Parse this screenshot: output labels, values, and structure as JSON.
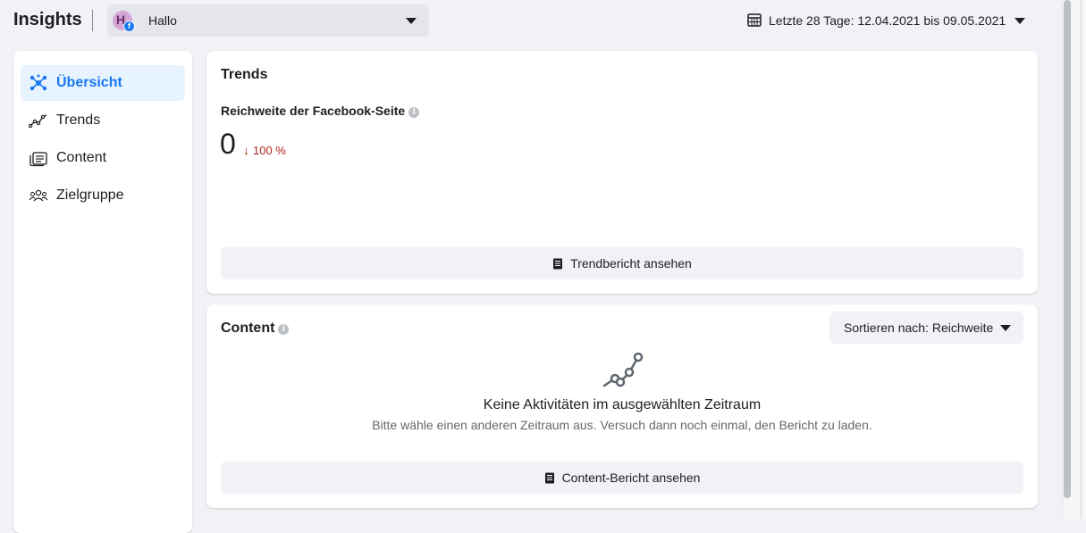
{
  "header": {
    "title": "Insights",
    "page_selector": {
      "avatar_letter": "H",
      "page_name": "Hallo"
    },
    "date_range": "Letzte 28 Tage: 12.04.2021 bis 09.05.2021"
  },
  "sidebar": {
    "items": [
      {
        "label": "Übersicht",
        "icon": "overview-icon",
        "active": true
      },
      {
        "label": "Trends",
        "icon": "trends-icon",
        "active": false
      },
      {
        "label": "Content",
        "icon": "content-icon",
        "active": false
      },
      {
        "label": "Zielgruppe",
        "icon": "audience-icon",
        "active": false
      }
    ]
  },
  "trends_card": {
    "title": "Trends",
    "metric_label": "Reichweite der Facebook-Seite",
    "metric_value": "0",
    "metric_change": "100 %",
    "report_button": "Trendbericht ansehen"
  },
  "content_card": {
    "title": "Content",
    "sort_label": "Sortieren nach: Reichweite",
    "empty_title": "Keine Aktivitäten im ausgewählten Zeitraum",
    "empty_subtitle": "Bitte wähle einen anderen Zeitraum aus. Versuch dann noch einmal, den Bericht zu laden.",
    "report_button": "Content-Bericht ansehen"
  },
  "colors": {
    "accent": "#1877f2",
    "negative": "#b3261e",
    "background": "#f0f2f5"
  }
}
